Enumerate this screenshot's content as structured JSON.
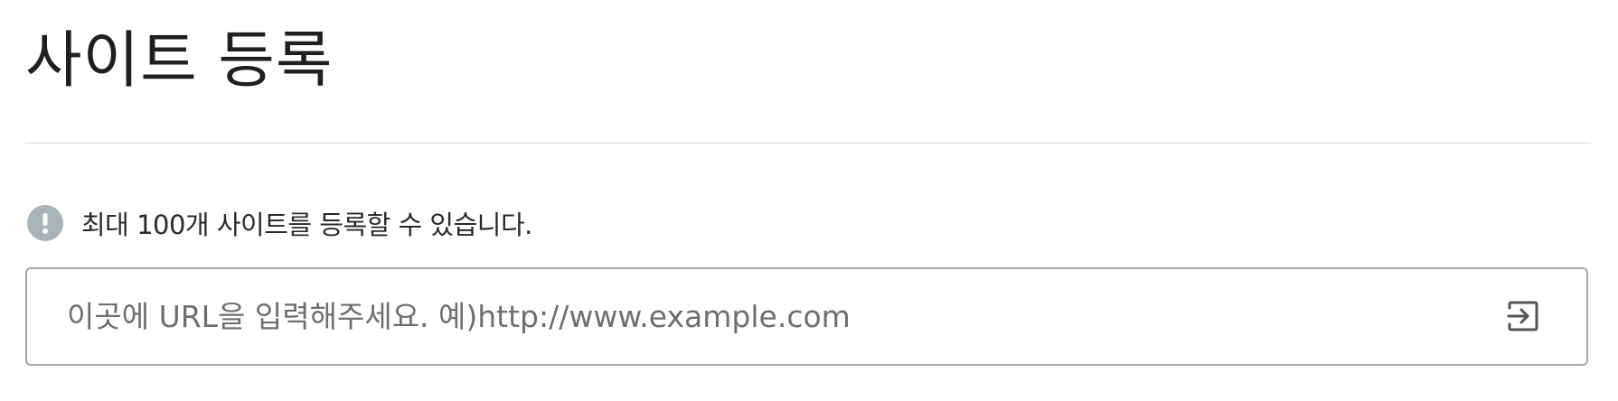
{
  "header": {
    "title": "사이트 등록"
  },
  "notice": {
    "icon": "exclamation-circle-icon",
    "icon_color": "#a9b3ba",
    "text": "최대 100개 사이트를 등록할 수 있습니다."
  },
  "url_field": {
    "value": "",
    "placeholder": "이곳에 URL을 입력해주세요. 예)http://www.example.com",
    "submit_icon": "enter-arrow-icon"
  }
}
